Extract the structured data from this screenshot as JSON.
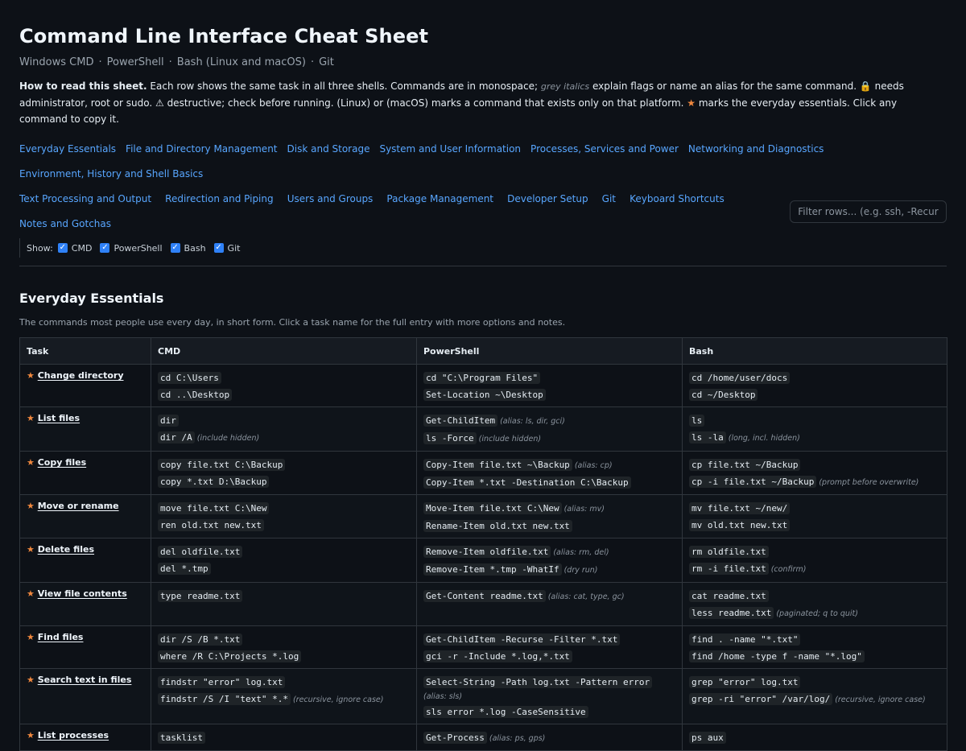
{
  "header": {
    "title": "Command Line Interface Cheat Sheet",
    "subtitle": [
      "Windows CMD",
      "PowerShell",
      "Bash (Linux and macOS)",
      "Git"
    ]
  },
  "howto": {
    "lead": "How to read this sheet.",
    "p1": " Each row shows the same task in all three shells. Commands are in monospace; ",
    "grey": "grey italics",
    "p2": " explain flags or name an alias for the same command. ",
    "lock_icon": "🔒",
    "p3": " needs administrator, root or sudo. ",
    "warn_icon": "⚠",
    "p4": " destructive; check before running. (Linux) or (macOS) marks a command that exists only on that platform. ",
    "star_icon": "★",
    "p5": " marks the everyday essentials. Click any command to copy it."
  },
  "nav": {
    "row1": [
      "Everyday Essentials",
      "File and Directory Management",
      "Disk and Storage",
      "System and User Information",
      "Processes, Services and Power",
      "Networking and Diagnostics",
      "Environment, History and Shell Basics"
    ],
    "row2": [
      "Text Processing and Output",
      "Redirection and Piping",
      "Users and Groups",
      "Package Management",
      "Developer Setup",
      "Git",
      "Keyboard Shortcuts",
      "Notes and Gotchas"
    ]
  },
  "filter": {
    "placeholder": "Filter rows... (e.g. ssh, -Recurse)"
  },
  "show": {
    "label": "Show:",
    "options": [
      "CMD",
      "PowerShell",
      "Bash",
      "Git"
    ]
  },
  "section": {
    "title": "Everyday Essentials",
    "description": "The commands most people use every day, in short form. Click a task name for the full entry with more options and notes.",
    "columns": [
      "Task",
      "CMD",
      "PowerShell",
      "Bash"
    ],
    "rows": [
      {
        "task": "Change directory",
        "cmd": [
          {
            "c": "cd C:\\Users"
          },
          {
            "c": "cd ..\\Desktop"
          }
        ],
        "ps": [
          {
            "c": "cd \"C:\\Program Files\""
          },
          {
            "c": "Set-Location ~\\Desktop"
          }
        ],
        "bash": [
          {
            "c": "cd /home/user/docs"
          },
          {
            "c": "cd ~/Desktop"
          }
        ]
      },
      {
        "task": "List files",
        "cmd": [
          {
            "c": "dir"
          },
          {
            "c": "dir /A",
            "n": "(include hidden)"
          }
        ],
        "ps": [
          {
            "c": "Get-ChildItem",
            "n": "(alias: ls, dir, gci)"
          },
          {
            "c": "ls -Force",
            "n": "(include hidden)"
          }
        ],
        "bash": [
          {
            "c": "ls"
          },
          {
            "c": "ls -la",
            "n": "(long, incl. hidden)"
          }
        ]
      },
      {
        "task": "Copy files",
        "cmd": [
          {
            "c": "copy file.txt C:\\Backup"
          },
          {
            "c": "copy *.txt D:\\Backup"
          }
        ],
        "ps": [
          {
            "c": "Copy-Item file.txt ~\\Backup",
            "n": "(alias: cp)"
          },
          {
            "c": "Copy-Item *.txt -Destination C:\\Backup"
          }
        ],
        "bash": [
          {
            "c": "cp file.txt ~/Backup"
          },
          {
            "c": "cp -i file.txt ~/Backup",
            "n": "(prompt before overwrite)"
          }
        ]
      },
      {
        "task": "Move or rename",
        "cmd": [
          {
            "c": "move file.txt C:\\New"
          },
          {
            "c": "ren old.txt new.txt"
          }
        ],
        "ps": [
          {
            "c": "Move-Item file.txt C:\\New",
            "n": "(alias: mv)"
          },
          {
            "c": "Rename-Item old.txt new.txt"
          }
        ],
        "bash": [
          {
            "c": "mv file.txt ~/new/"
          },
          {
            "c": "mv old.txt new.txt"
          }
        ]
      },
      {
        "task": "Delete files",
        "cmd": [
          {
            "c": "del oldfile.txt"
          },
          {
            "c": "del *.tmp"
          }
        ],
        "ps": [
          {
            "c": "Remove-Item oldfile.txt",
            "n": "(alias: rm, del)"
          },
          {
            "c": "Remove-Item *.tmp -WhatIf",
            "n": "(dry run)"
          }
        ],
        "bash": [
          {
            "c": "rm oldfile.txt"
          },
          {
            "c": "rm -i file.txt",
            "n": "(confirm)"
          }
        ]
      },
      {
        "task": "View file contents",
        "cmd": [
          {
            "c": "type readme.txt"
          }
        ],
        "ps": [
          {
            "c": "Get-Content readme.txt",
            "n": "(alias: cat, type, gc)"
          }
        ],
        "bash": [
          {
            "c": "cat readme.txt"
          },
          {
            "c": "less readme.txt",
            "n": "(paginated; q to quit)"
          }
        ]
      },
      {
        "task": "Find files",
        "cmd": [
          {
            "c": "dir /S /B *.txt"
          },
          {
            "c": "where /R C:\\Projects *.log"
          }
        ],
        "ps": [
          {
            "c": "Get-ChildItem -Recurse -Filter *.txt"
          },
          {
            "c": "gci -r -Include *.log,*.txt"
          }
        ],
        "bash": [
          {
            "c": "find . -name \"*.txt\""
          },
          {
            "c": "find /home -type f -name \"*.log\""
          }
        ]
      },
      {
        "task": "Search text in files",
        "cmd": [
          {
            "c": "findstr \"error\" log.txt"
          },
          {
            "c": "findstr /S /I \"text\" *.*",
            "n": "(recursive, ignore case)"
          }
        ],
        "ps": [
          {
            "c": "Select-String -Path log.txt -Pattern error",
            "nw": "(alias: sls)"
          },
          {
            "c": "sls error *.log -CaseSensitive"
          }
        ],
        "bash": [
          {
            "c": "grep \"error\" log.txt"
          },
          {
            "c": "grep -ri \"error\" /var/log/",
            "n": "(recursive, ignore case)"
          }
        ]
      },
      {
        "task": "List processes",
        "cmd": [
          {
            "c": "tasklist"
          }
        ],
        "ps": [
          {
            "c": "Get-Process",
            "n": "(alias: ps, gps)"
          }
        ],
        "bash": [
          {
            "c": "ps aux"
          }
        ]
      }
    ]
  }
}
